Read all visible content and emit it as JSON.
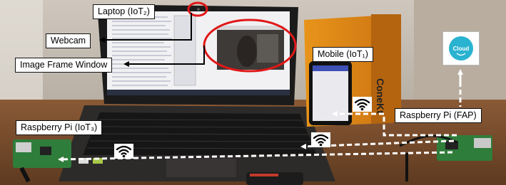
{
  "labels": {
    "laptop": "Laptop (IoT₂)",
    "webcam": "Webcam",
    "image_frame_window": "Image Frame Window",
    "mobile": "Mobile (IoT₁)",
    "raspberry_pi_iot3": "Raspberry Pi (IoT₃)",
    "raspberry_pi_fap": "Raspberry Pi (FAP)",
    "cloud": "Cloud"
  },
  "box_brand_text": "ConeKt",
  "icons": [
    "wifi-icon",
    "cloud-icon",
    "webcam-icon"
  ],
  "colors": {
    "highlight_circle": "#e01818",
    "label_border": "#111111",
    "arrow": "#ffffff"
  }
}
